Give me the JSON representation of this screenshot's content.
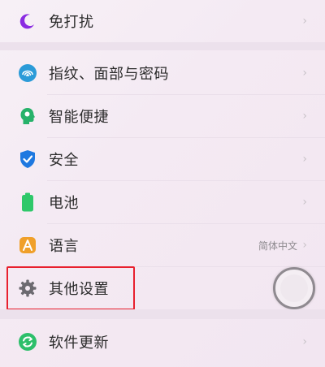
{
  "settings": {
    "items": [
      {
        "label": "免打扰",
        "icon": "moon-icon",
        "color": "#8a2be2"
      },
      {
        "label": "指纹、面部与密码",
        "icon": "fingerprint-icon",
        "color": "#2b9bd8"
      },
      {
        "label": "智能便捷",
        "icon": "smart-head-icon",
        "color": "#27b26a"
      },
      {
        "label": "安全",
        "icon": "shield-check-icon",
        "color": "#1e78e0"
      },
      {
        "label": "电池",
        "icon": "battery-icon",
        "color": "#2ec86a"
      },
      {
        "label": "语言",
        "icon": "language-icon",
        "color": "#f0a02a",
        "value": "简体中文"
      },
      {
        "label": "其他设置",
        "icon": "gear-icon",
        "color": "#6c6a70"
      },
      {
        "label": "软件更新",
        "icon": "update-icon",
        "color": "#2dbf6b"
      }
    ],
    "chevron": "›"
  },
  "icon_glyphs": {
    "language": "A"
  }
}
